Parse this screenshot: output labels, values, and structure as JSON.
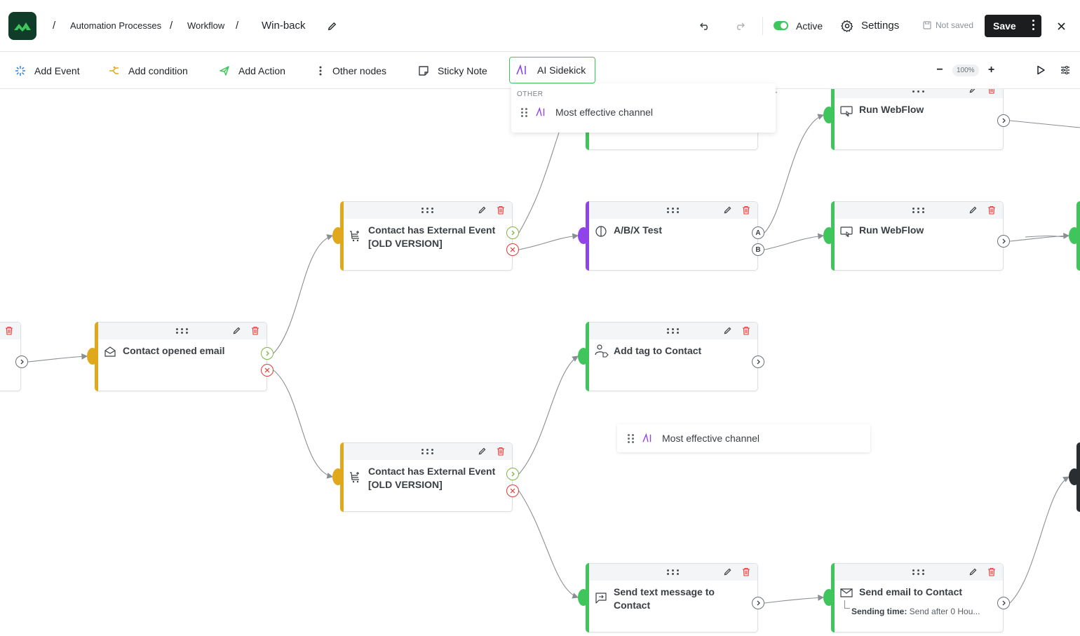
{
  "header": {
    "breadcrumb": [
      "Automation Processes",
      "Workflow"
    ],
    "current": "Win-back",
    "sep": "/",
    "active_label": "Active",
    "settings_label": "Settings",
    "not_saved_label": "Not saved",
    "save_label": "Save"
  },
  "toolbar": {
    "add_event": "Add Event",
    "add_condition": "Add condition",
    "add_action": "Add Action",
    "other_nodes": "Other nodes",
    "sticky_note": "Sticky Note",
    "ai_sidekick": "AI Sidekick",
    "zoom": "100%",
    "zoom_out": "−",
    "zoom_in": "+"
  },
  "dropdown": {
    "heading": "OTHER",
    "item": "Most effective channel"
  },
  "floating_item": "Most effective channel",
  "nodes": {
    "contact_opened": {
      "title": "Contact opened email"
    },
    "ext_event_top": {
      "title": "Contact has External Event [OLD VERSION]"
    },
    "ext_event_bottom": {
      "title": "Contact has External Event [OLD VERSION]"
    },
    "ab_test": {
      "title": "A/B/X Test",
      "port_a": "A",
      "port_b": "B"
    },
    "add_tag": {
      "title": "Add tag to Contact"
    },
    "send_text": {
      "title": "Send text message to Contact"
    },
    "run_webflow_1": {
      "title": "Run WebFlow"
    },
    "run_webflow_2": {
      "title": "Run WebFlow"
    },
    "send_email": {
      "title": "Send email to Contact",
      "sub_label": "Sending time:",
      "sub_value": " Send after 0 Hou..."
    }
  },
  "colors": {
    "condition": "#e0a81c",
    "action": "#3fc55b",
    "abtest": "#8e44e8",
    "ai": "#8e44e8",
    "accent": "#3fc55b"
  }
}
